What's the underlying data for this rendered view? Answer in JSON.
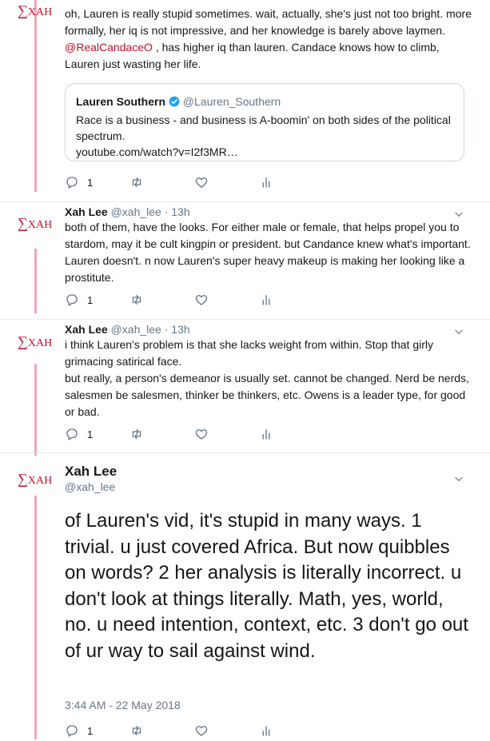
{
  "logo_text": "XAH",
  "tweet1": {
    "text_before": "oh, Lauren is really stupid sometimes. wait, actually, she's just not too bright. more formally, her iq is not impressive, and her knowledge is barely above laymen. ",
    "mention": "@RealCandaceO",
    "text_after": " , has higher iq than lauren. Candace knows how to climb, Lauren just wasting her life.",
    "quote": {
      "name": "Lauren Southern",
      "handle": "@Lauren_Southern",
      "text": "Race is a business - and business is A-boomin' on both sides of the political spectrum.",
      "link": "youtube.com/watch?v=I2f3MR…"
    },
    "reply_count": "1"
  },
  "tweet2": {
    "name": "Xah Lee",
    "handle": "@xah_lee · 13h",
    "text": "both of them, have the looks. For either male or female, that helps propel you to stardom, may it be cult kingpin or president. but Candance knew what's important. Lauren doesn't. n now Lauren's super heavy makeup is making her looking like a prostitute.",
    "reply_count": "1"
  },
  "tweet3": {
    "name": "Xah Lee",
    "handle": "@xah_lee · 13h",
    "text_p1": "i think Lauren's problem is that she lacks weight from within. Stop that girly grimacing satirical face.",
    "text_p2": "but really, a person's demeanor is usually set. cannot be changed. Nerd be nerds, salesmen be salesmen, thinker be thinkers, etc. Owens is a leader type, for good or bad.",
    "reply_count": "1"
  },
  "tweet4": {
    "name": "Xah Lee",
    "handle": "@xah_lee",
    "text": "of Lauren's vid, it's stupid in many ways. 1 trivial. u just covered Africa. But now quibbles on words? 2 her analysis is literally incorrect. u don't look at things literally. Math, yes, world, no. u need intention, context, etc. 3 don't go out of ur way to sail against wind.",
    "timestamp": "3:44 AM - 22 May 2018",
    "reply_count": "1"
  },
  "colors": {
    "thread_line": "#f0a6b8",
    "mention": "#c8102e",
    "muted": "#657786",
    "verified": "#1da1f2"
  }
}
